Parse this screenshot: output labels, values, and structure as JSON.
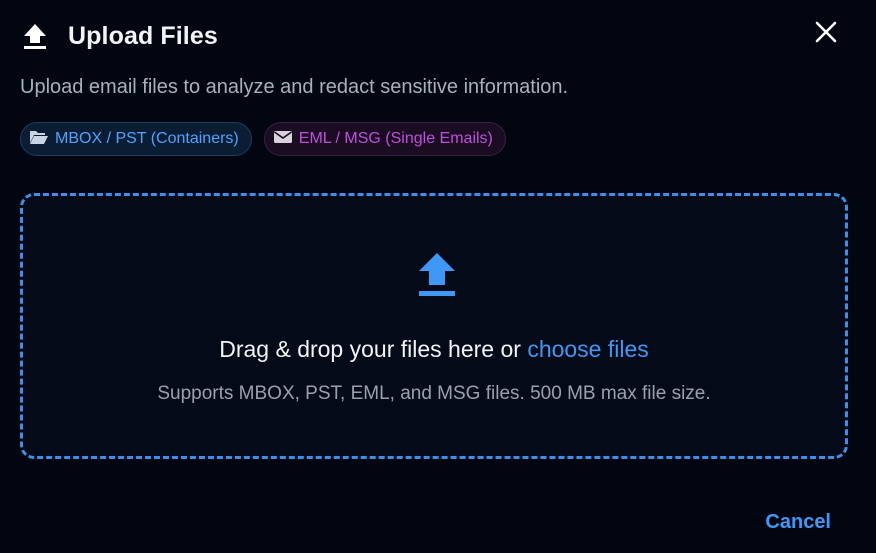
{
  "dialog": {
    "title": "Upload Files",
    "description": "Upload email files to analyze and redact sensitive information.",
    "close_icon": "close-icon",
    "header_icon": "upload-icon"
  },
  "chips": [
    {
      "label": "MBOX / PST (Containers)",
      "icon": "folder-open-icon",
      "color": "#4da3ff"
    },
    {
      "label": "EML / MSG (Single Emails)",
      "icon": "envelope-icon",
      "color": "#c04ee0"
    }
  ],
  "dropzone": {
    "icon": "upload-icon",
    "prompt_text": "Drag & drop your files here or",
    "link_text": "choose files",
    "support_text": "Supports MBOX, PST, EML, and MSG files. 500 MB max file size.",
    "border_color": "#3f8fe8"
  },
  "footer": {
    "cancel_label": "Cancel"
  },
  "colors": {
    "background": "#020611",
    "accent": "#3f98f5"
  }
}
